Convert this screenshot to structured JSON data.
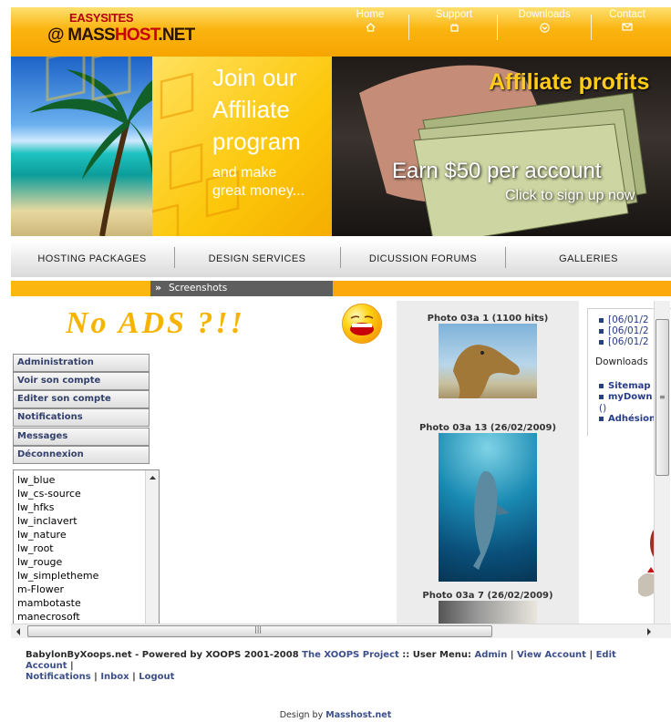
{
  "header": {
    "logo_top": "EASYSITES",
    "logo_at": "@",
    "logo_brand_a": "MASS",
    "logo_brand_b": "HOST",
    "logo_brand_c": ".NET",
    "nav": [
      {
        "label": "Home",
        "icon": "home-icon"
      },
      {
        "label": "Support",
        "icon": "support-icon"
      },
      {
        "label": "Downloads",
        "icon": "download-icon"
      },
      {
        "label": "Contact",
        "icon": "mail-icon"
      }
    ]
  },
  "banner": {
    "join_line1": "Join our",
    "join_line2": "Affiliate",
    "join_line3": "program",
    "money_line1": "and make",
    "money_line2": "great money...",
    "affiliate": "Affiliate profits",
    "earn": "Earn $50 per account",
    "click": "Click to sign up now"
  },
  "tabs": [
    "HOSTING PACKAGES",
    "DESIGN SERVICES",
    "DICUSSION FORUMS",
    "GALLERIES"
  ],
  "breadcrumb": {
    "arrow": "»",
    "label": "Screenshots"
  },
  "content": {
    "noads": "No ADS ?!!",
    "user_menu": [
      "Administration",
      "Voir son compte",
      "Editer son compte",
      "Notifications",
      "Messages",
      "Déconnexion"
    ],
    "themes": [
      "lw_blue",
      "lw_cs-source",
      "lw_hfks",
      "lw_inclavert",
      "lw_nature",
      "lw_root",
      "lw_rouge",
      "lw_simpletheme",
      "m-Flower",
      "mambotaste",
      "manecrosoft"
    ],
    "photos": [
      {
        "title": "Photo 03a 1 (1100 hits)"
      },
      {
        "title": "Photo 03a 13 (26/02/2009)"
      },
      {
        "title": "Photo 03a 7 (26/02/2009)"
      }
    ],
    "right_links": [
      "[06/01/2",
      "[06/01/2",
      "[06/01/2"
    ],
    "downloads_title": "Downloads",
    "downloads_links": [
      "Sitemap",
      "myDown",
      "()",
      "Adhésion"
    ]
  },
  "footer": {
    "site": "BabylonByXoops.net",
    "powered": " - Powered by XOOPS 2001-2008 ",
    "project": "The XOOPS Project",
    "user_menu_label": " :: User Menu: ",
    "links": [
      "Admin",
      "View Account",
      "Edit Account",
      "Notifications",
      "Inbox",
      "Logout"
    ],
    "design_prefix": "Design by ",
    "design_link": "Masshost.net"
  },
  "colors": {
    "accent": "#fbb410",
    "link": "#3c4f8a",
    "dark": "#5e5e5e"
  }
}
